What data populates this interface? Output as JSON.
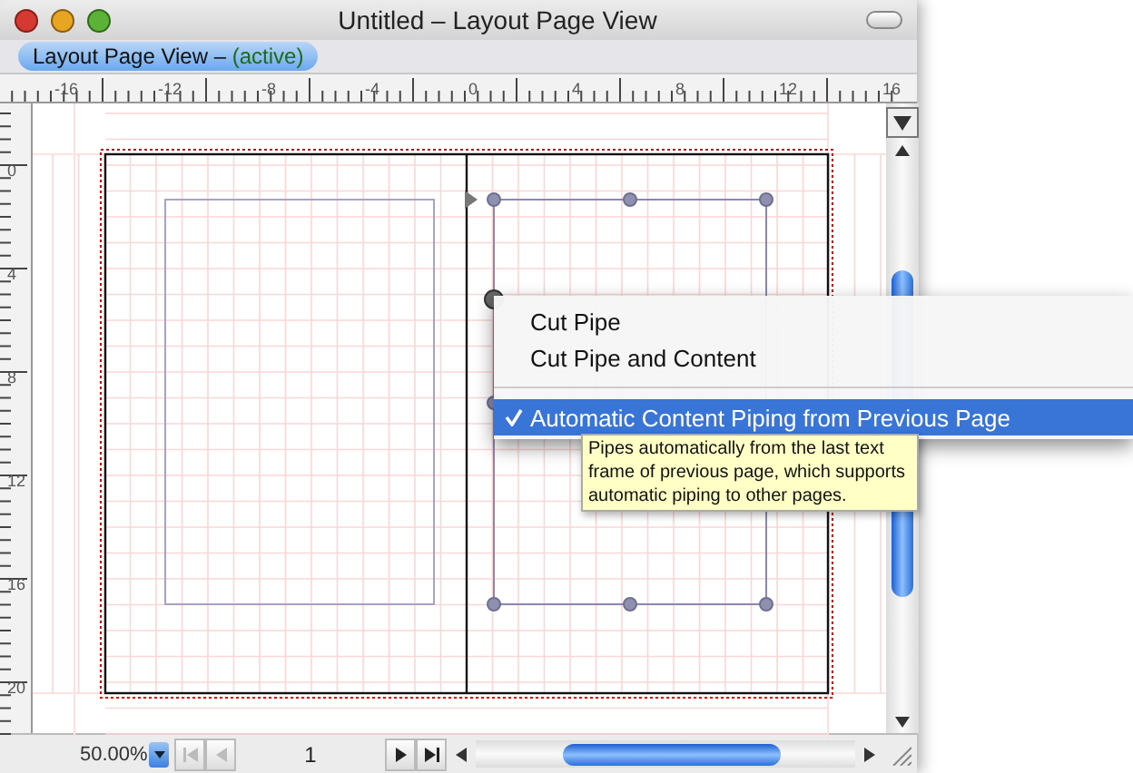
{
  "window": {
    "title": "Untitled – Layout Page View"
  },
  "tab": {
    "label": "Layout Page View –",
    "status": "(active)",
    "selected": true
  },
  "ruler_h": {
    "labels": [
      "-16",
      "-12",
      "-8",
      "-4",
      "0",
      "4",
      "8",
      "12",
      "16"
    ]
  },
  "ruler_v": {
    "labels": [
      "0",
      "4",
      "8",
      "12",
      "16",
      "20"
    ]
  },
  "context_menu": {
    "items": [
      {
        "kind": "item",
        "label": "Cut Pipe",
        "checked": false,
        "selected": false
      },
      {
        "kind": "item",
        "label": "Cut Pipe and Content",
        "checked": false,
        "selected": false
      },
      {
        "kind": "separator"
      },
      {
        "kind": "item",
        "label": "Automatic Content Piping from Previous Page",
        "checked": true,
        "selected": true
      }
    ]
  },
  "tooltip": {
    "text": "Pipes automatically from the last text frame of previous page, which supports automatic piping to other pages."
  },
  "status_bar": {
    "zoom": "50.00%",
    "page": "1",
    "nav_buttons": [
      {
        "kind": "first",
        "disabled": true
      },
      {
        "kind": "prev",
        "disabled": true
      },
      {
        "kind": "next",
        "disabled": false
      },
      {
        "kind": "last",
        "disabled": false
      }
    ]
  }
}
